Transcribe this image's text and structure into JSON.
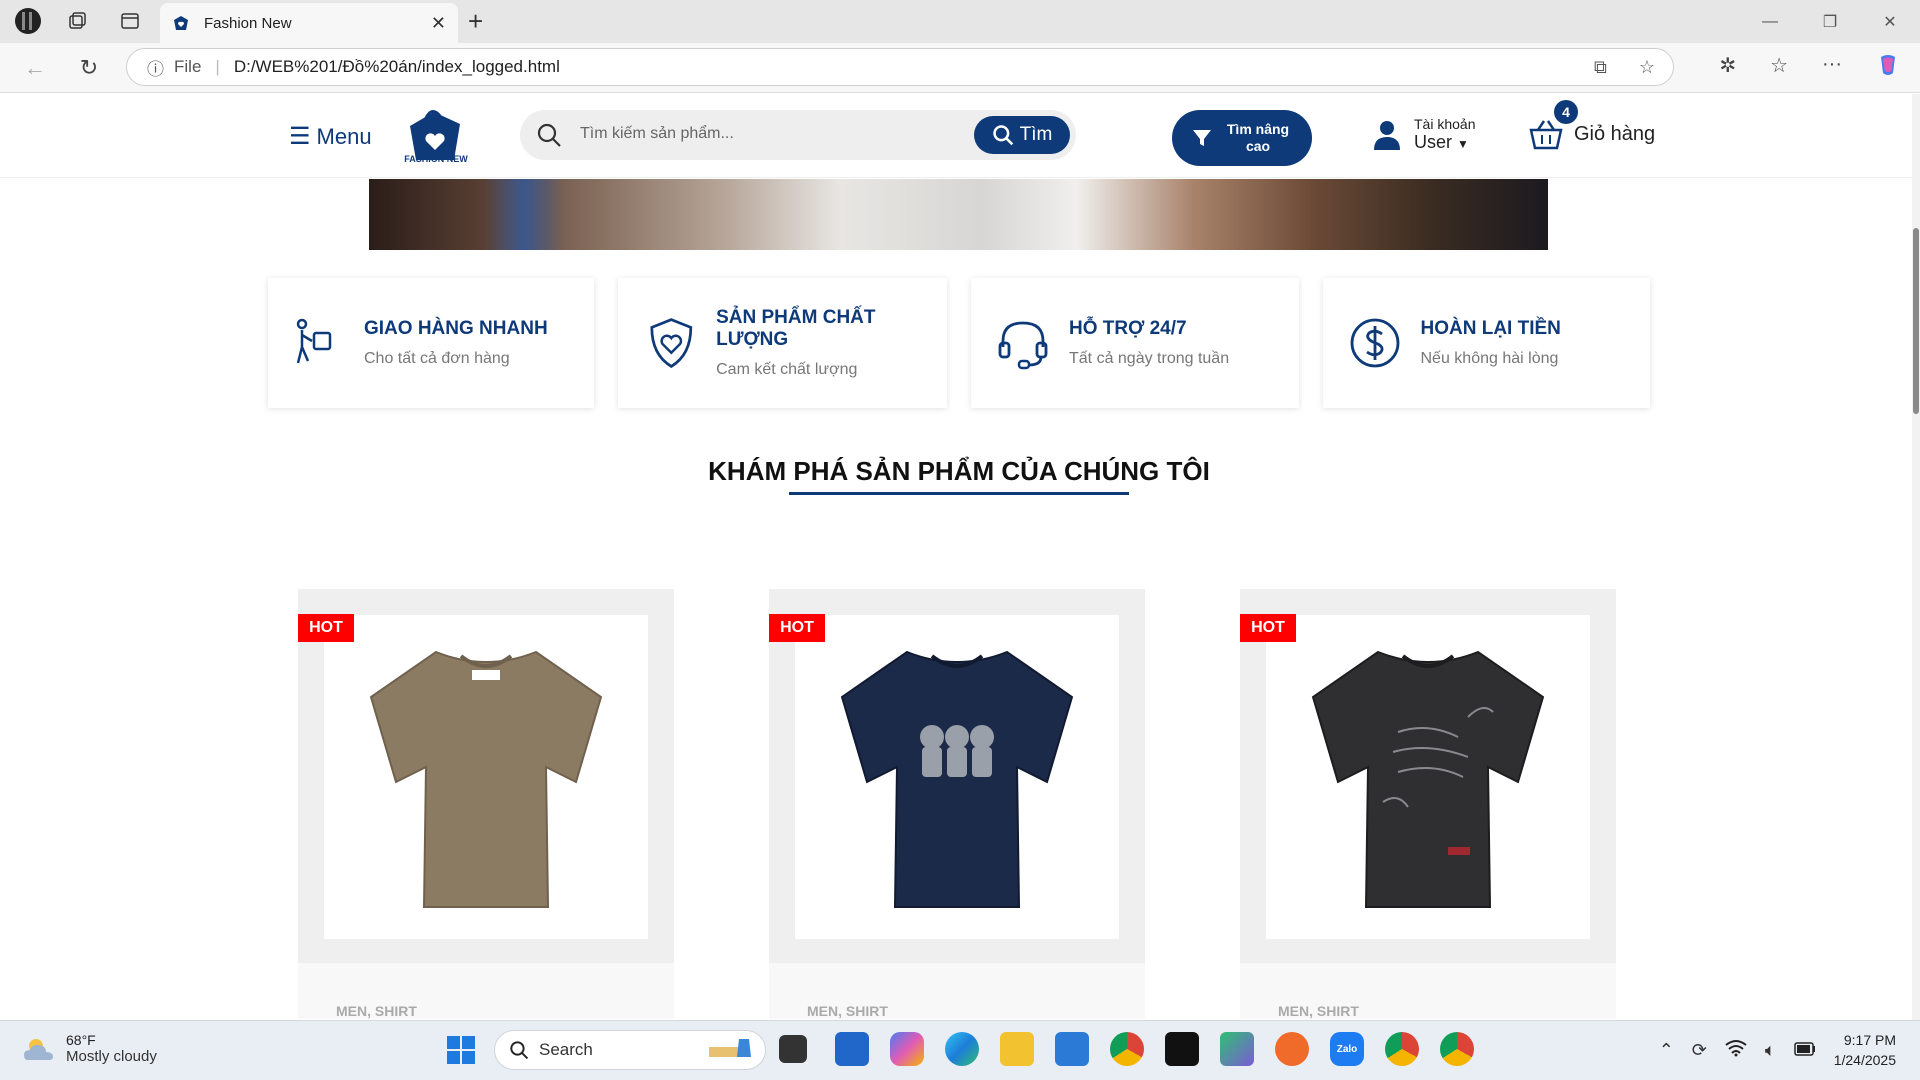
{
  "browser": {
    "tab_title": "Fashion New",
    "url_scheme": "File",
    "url": "D:/WEB%201/Đồ%20án/index_logged.html"
  },
  "header": {
    "menu_label": "Menu",
    "logo_text": "FASHION NEW",
    "search_placeholder": "Tìm kiếm sản phẩm...",
    "search_button": "Tìm",
    "advanced_search": "Tìm nâng cao",
    "account_label": "Tài khoản",
    "account_user": "User",
    "cart_label": "Giỏ hàng",
    "cart_count": "4"
  },
  "features": [
    {
      "title": "GIAO HÀNG NHANH",
      "subtitle": "Cho tất cả đơn hàng",
      "icon": "delivery-person-icon"
    },
    {
      "title": "SẢN PHẨM CHẤT LƯỢNG",
      "subtitle": "Cam kết chất lượng",
      "icon": "shield-heart-icon"
    },
    {
      "title": "HỖ TRỢ 24/7",
      "subtitle": "Tất cả ngày trong tuần",
      "icon": "headset-icon"
    },
    {
      "title": "HOÀN LẠI TIỀN",
      "subtitle": "Nếu không hài lòng",
      "icon": "dollar-circle-icon"
    }
  ],
  "section_title": "KHÁM PHÁ SẢN PHẨM CỦA CHÚNG TÔI",
  "products": [
    {
      "badge": "HOT",
      "category": "MEN, SHIRT",
      "color": "#8c7b63"
    },
    {
      "badge": "HOT",
      "category": "MEN, SHIRT",
      "color": "#1c2a4a"
    },
    {
      "badge": "HOT",
      "category": "MEN, SHIRT",
      "color": "#2f2f31"
    }
  ],
  "taskbar": {
    "temperature": "68°F",
    "weather": "Mostly cloudy",
    "search_label": "Search",
    "time": "9:17 PM",
    "date": "1/24/2025",
    "zalo_label": "Zalo"
  },
  "colors": {
    "brand": "#0e3a79",
    "hot_badge": "#ff0000"
  }
}
